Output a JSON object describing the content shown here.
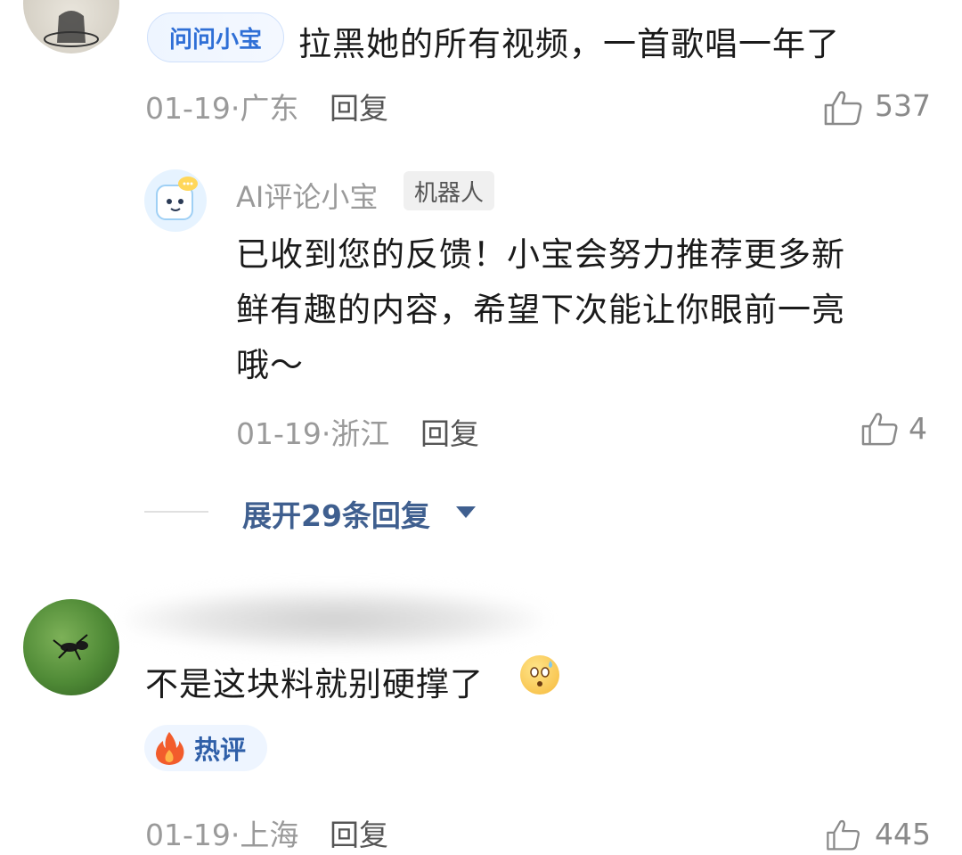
{
  "comment1": {
    "badge": "问问小宝",
    "text": "拉黑她的所有视频，一首歌唱一年了",
    "meta": "01-19·广东",
    "reply": "回复",
    "likes": "537"
  },
  "ai_reply": {
    "name": "AI评论小宝",
    "tag": "机器人",
    "lines": [
      "已收到您的反馈！小宝会努力推荐更多新",
      "鲜有趣的内容，希望下次能让你眼前一亮",
      "哦～"
    ],
    "meta": "01-19·浙江",
    "reply": "回复",
    "likes": "4"
  },
  "expand": {
    "label": "展开29条回复"
  },
  "comment2": {
    "text": "不是这块料就别硬撑了",
    "hot_badge": "热评",
    "meta": "01-19·上海",
    "reply": "回复",
    "likes": "445"
  },
  "colors": {
    "accent_blue": "#2f6fd6",
    "expand_blue": "#3f5f8f",
    "meta_gray": "#9a9a9a"
  },
  "icons": [
    "thumbs-up-icon",
    "flame-icon",
    "chevron-down-icon",
    "chat-bubble-icon"
  ]
}
